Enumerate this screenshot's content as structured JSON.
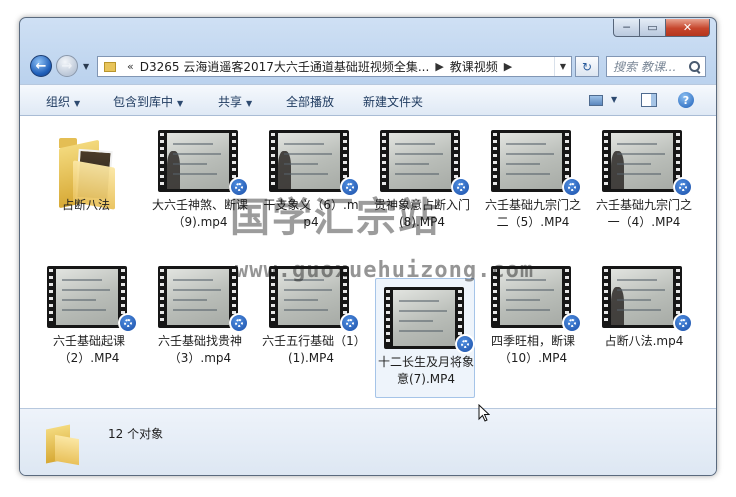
{
  "window": {
    "min_label": "─",
    "max_label": "▭",
    "close_label": "✕"
  },
  "navigation": {
    "back_glyph": "←",
    "forward_glyph": "→",
    "address": {
      "overflow": "«",
      "crumbs": [
        "D3265 云海逍遥客2017大六壬通道基础班视频全集...",
        "教课视频"
      ]
    },
    "search_placeholder": "搜索 教课..."
  },
  "toolbar": {
    "organize": "组织",
    "include_in_library": "包含到库中",
    "share": "共享",
    "play_all": "全部播放",
    "new_folder": "新建文件夹"
  },
  "items": [
    {
      "type": "folder",
      "label": "占断八法"
    },
    {
      "type": "video",
      "label": "大六壬神煞、断课（9).mp4"
    },
    {
      "type": "video",
      "label": "干支象义（6）.mp4"
    },
    {
      "type": "video",
      "label": "贵神象意占断入门(8).MP4"
    },
    {
      "type": "video",
      "label": "六壬基础九宗门之二（5）.MP4"
    },
    {
      "type": "video",
      "label": "六壬基础九宗门之一（4）.MP4"
    },
    {
      "type": "video",
      "label": "六壬基础起课（2）.MP4"
    },
    {
      "type": "video",
      "label": "六壬基础找贵神（3）.mp4"
    },
    {
      "type": "video",
      "label": "六壬五行基础（1）(1).MP4"
    },
    {
      "type": "video",
      "label": "十二长生及月将象意(7).MP4",
      "selected": true
    },
    {
      "type": "video",
      "label": "四季旺相，断课（10）.MP4"
    },
    {
      "type": "video",
      "label": "占断八法.mp4"
    }
  ],
  "watermark": {
    "cn": "国学汇宗站",
    "url": "www.guoxuehuizong.com"
  },
  "status": {
    "count_text": "12 个对象"
  }
}
